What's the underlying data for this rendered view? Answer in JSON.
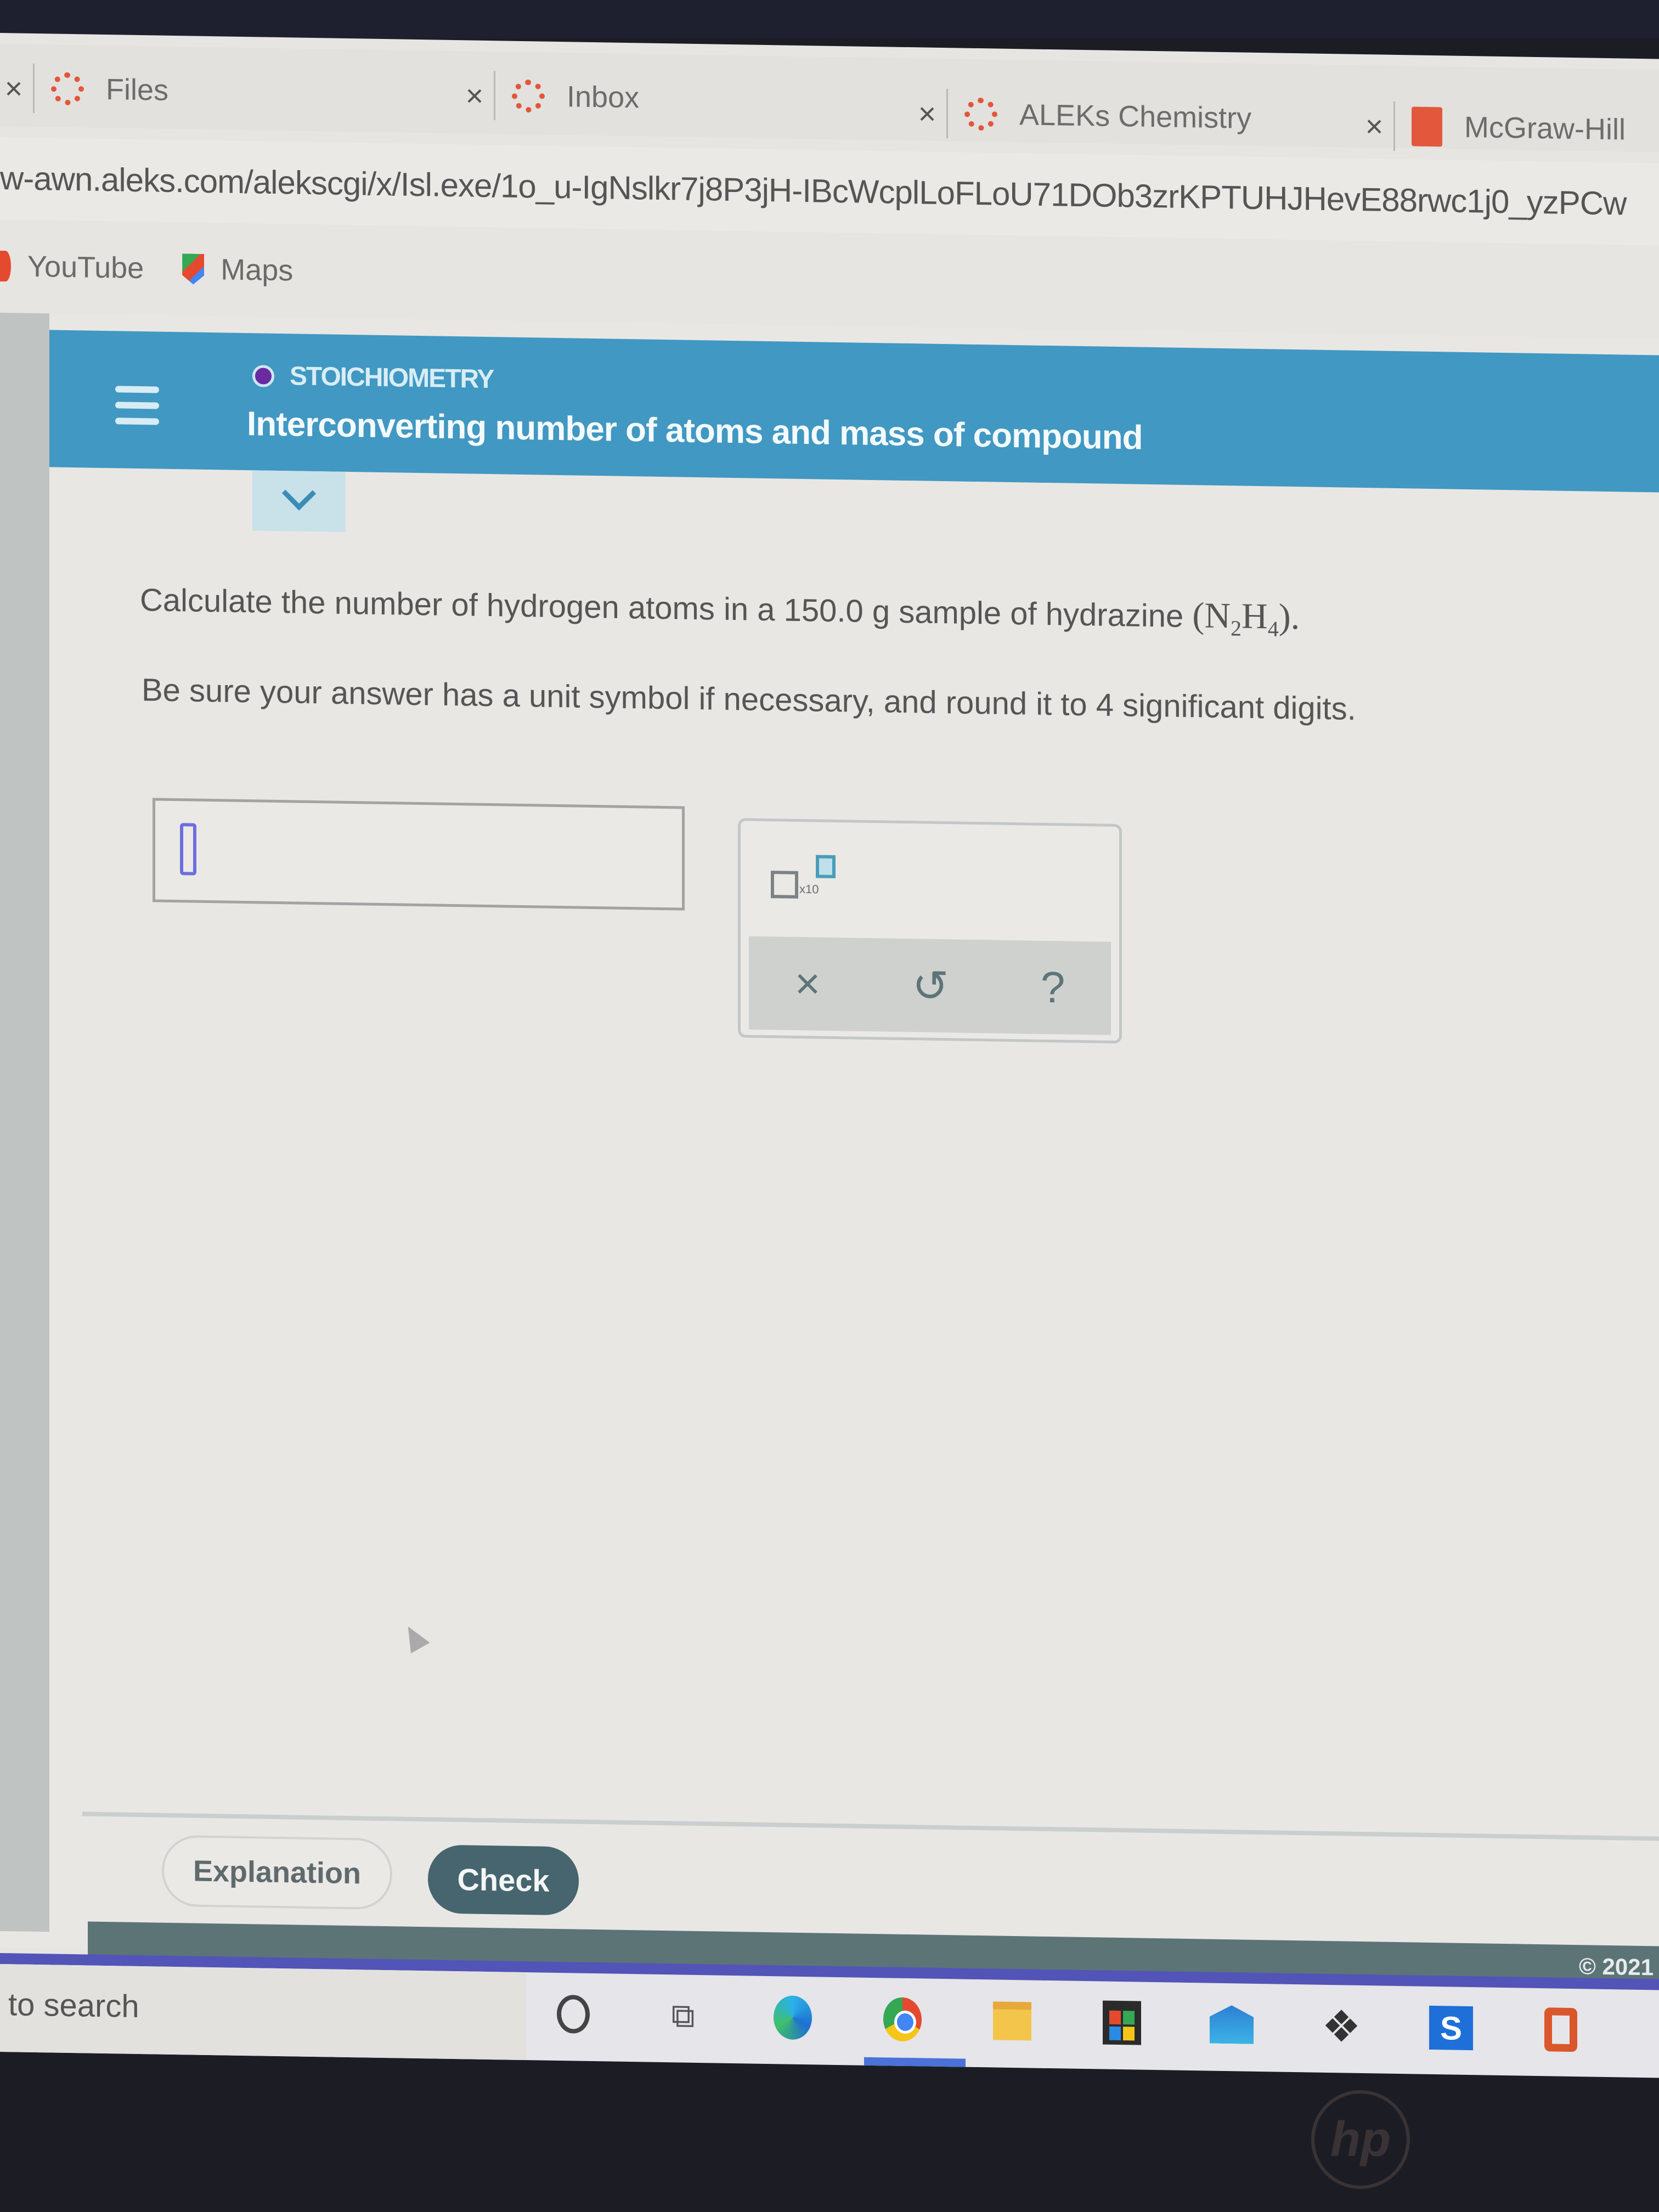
{
  "browser": {
    "tabs": [
      {
        "label": "Files",
        "icon": "canvas-icon"
      },
      {
        "label": "Inbox",
        "icon": "canvas-icon"
      },
      {
        "label": "ALEKs Chemistry",
        "icon": "canvas-icon"
      },
      {
        "label": "McGraw-Hill",
        "icon": "mcgraw-hill-icon"
      }
    ],
    "close_glyph": "×",
    "url": "w-awn.aleks.com/alekscgi/x/Isl.exe/1o_u-IgNslkr7j8P3jH-IBcWcplLoFLoU71DOb3zrKPTUHJHevE88rwc1j0_yzPCw",
    "bookmarks": [
      {
        "label": "YouTube"
      },
      {
        "label": "Maps"
      }
    ]
  },
  "aleks": {
    "topic": "STOICHIOMETRY",
    "title": "Interconverting number of atoms and mass of compound",
    "question": {
      "prefix": "Calculate the number of hydrogen atoms in a 150.0 g sample of hydrazine ",
      "formula_open": "(",
      "formula_n": "N",
      "formula_n_sub": "2",
      "formula_h": "H",
      "formula_h_sub": "4",
      "formula_close": ").",
      "instruction": "Be sure your answer has a unit symbol if necessary, and round it to 4 significant digits."
    },
    "answer_value": "",
    "palette": {
      "sci_notation_label": "x10",
      "clear_glyph": "×",
      "undo_glyph": "↺",
      "help_glyph": "?"
    },
    "buttons": {
      "explanation": "Explanation",
      "check": "Check"
    },
    "copyright": "© 2021"
  },
  "taskbar": {
    "search_placeholder": "to search",
    "taskview_glyph": "⧉",
    "dropbox_glyph": "❖",
    "app_s_glyph": "S",
    "apps": [
      "cortana",
      "task-view",
      "edge",
      "chrome",
      "file-explorer",
      "microsoft-store",
      "mail",
      "dropbox",
      "app-s",
      "office"
    ]
  },
  "device": {
    "logo": "hp"
  }
}
